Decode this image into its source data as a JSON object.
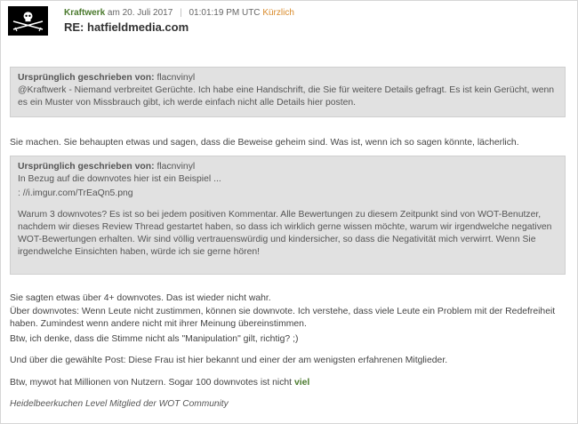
{
  "post": {
    "author": "Kraftwerk",
    "date_prefix": "am 20. Juli 2017",
    "time": "01:01:19 PM UTC",
    "recent": "Kürzlich",
    "title": "RE: hatfieldmedia.com"
  },
  "quote1": {
    "head_label": "Ursprünglich geschrieben von:",
    "head_user": "flacnvinyl",
    "text": "@Kraftwerk - Niemand verbreitet Gerüchte. Ich habe eine Handschrift, die Sie für weitere Details gefragt. Es ist kein Gerücht, wenn es ein Muster von Missbrauch gibt, ich werde einfach nicht alle Details hier posten."
  },
  "para1": "Sie machen. Sie behaupten etwas und sagen, dass die Beweise geheim sind. Was ist, wenn ich so sagen könnte, lächerlich.",
  "quote2": {
    "head_label": "Ursprünglich geschrieben von:",
    "head_user": "flacnvinyl",
    "line1": "In Bezug auf die downvotes hier ist ein Beispiel ...",
    "line2": ": //i.imgur.com/TrEaQn5.png",
    "text": "Warum 3 downvotes? Es ist so bei jedem positiven Kommentar. Alle Bewertungen zu diesem Zeitpunkt sind von WOT-Benutzer, nachdem wir dieses Review Thread gestartet haben, so dass ich wirklich gerne wissen möchte, warum wir irgendwelche negativen WOT-Bewertungen erhalten. Wir sind völlig vertrauenswürdig und kindersicher, so dass die Negativität mich verwirrt. Wenn Sie irgendwelche Einsichten haben, würde ich sie gerne hören!"
  },
  "para2_l1": "Sie sagten etwas über 4+ downvotes. Das ist wieder nicht wahr.",
  "para2_l2": "Über downvotes: Wenn Leute nicht zustimmen, können sie downvote. Ich verstehe, dass viele Leute ein Problem mit der Redefreiheit haben. Zumindest wenn andere nicht mit ihrer Meinung übereinstimmen.",
  "para3": "Btw, ich denke, dass die Stimme nicht als \"Manipulation\" gilt, richtig? ;)",
  "para4": "Und über die gewählte Post: Diese Frau ist hier bekannt und einer der am wenigsten erfahrenen Mitglieder.",
  "para5": "Btw, mywot hat Millionen von Nutzern. Sogar 100 downvotes ist nicht",
  "para5_hl": "viel",
  "signature": "Heidelbeerkuchen Level Mitglied der WOT Community"
}
